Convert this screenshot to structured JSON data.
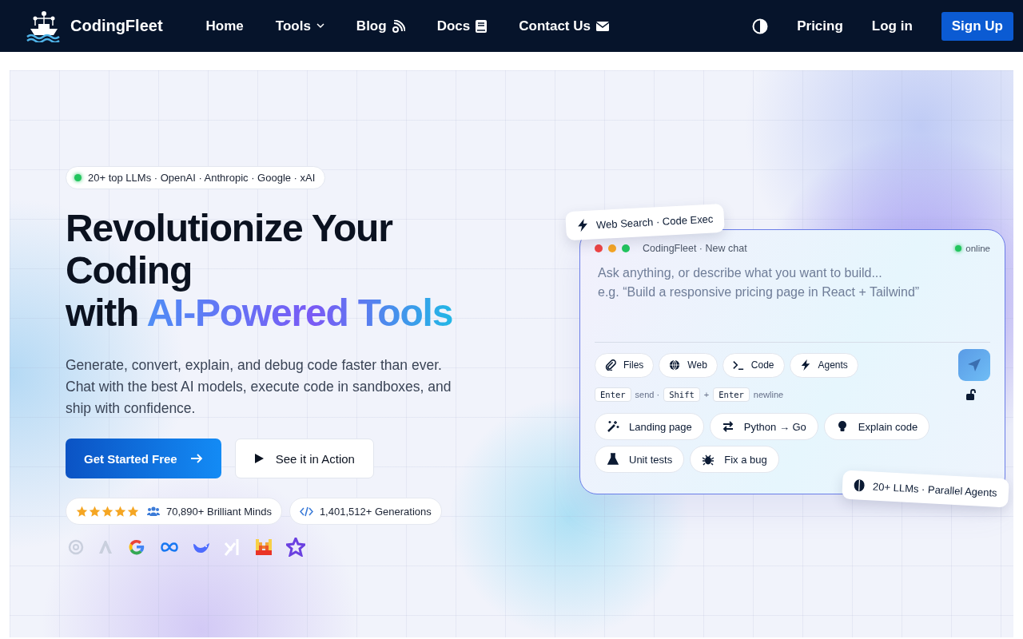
{
  "nav": {
    "brand": "CodingFleet",
    "links": [
      {
        "label": "Home"
      },
      {
        "label": "Tools"
      },
      {
        "label": "Blog"
      },
      {
        "label": "Docs"
      },
      {
        "label": "Contact Us"
      }
    ],
    "pricing": "Pricing",
    "login": "Log in",
    "signup": "Sign Up"
  },
  "hero": {
    "badge": "20+ top LLMs · OpenAI · Anthropic · Google · xAI",
    "headline": [
      "Revolutionize Your",
      "Coding",
      "with "
    ],
    "headline_accent": "AI-Powered Tools",
    "subtitle": "Generate, convert, explain, and debug code faster than ever. Chat with the best AI models, execute code in sandboxes, and ship with confidence.",
    "primary_button": "Get Started Free",
    "secondary_button": "See it in Action",
    "rating": {
      "stars": 5,
      "text": "70,890+ Brilliant Minds"
    },
    "generations": "1,401,512+ Generations"
  },
  "chat": {
    "top_tag": "Web Search · Code Exec",
    "title": "CodingFleet · New chat",
    "status": "online",
    "placeholder": "Ask anything, or describe what you want to build...\ne.g. “Build a responsive pricing page in React + Tailwind”",
    "tools": [
      {
        "label": "Files"
      },
      {
        "label": "Web"
      },
      {
        "label": "Code"
      },
      {
        "label": "Agents"
      }
    ],
    "hints": [
      {
        "kind": "key",
        "text": "Enter"
      },
      {
        "kind": "text",
        "text": "send ·"
      },
      {
        "kind": "key",
        "text": "Shift"
      },
      {
        "kind": "text",
        "text": "+"
      },
      {
        "kind": "key",
        "text": "Enter"
      },
      {
        "kind": "text",
        "text": "newline"
      }
    ],
    "suggestions": [
      {
        "label": "Landing page"
      },
      {
        "label": "Python → Go"
      },
      {
        "label": "Explain code"
      },
      {
        "label": "Unit tests"
      },
      {
        "label": "Fix a bug"
      }
    ],
    "bottom_tag": "20+ LLMs · Parallel Agents"
  }
}
